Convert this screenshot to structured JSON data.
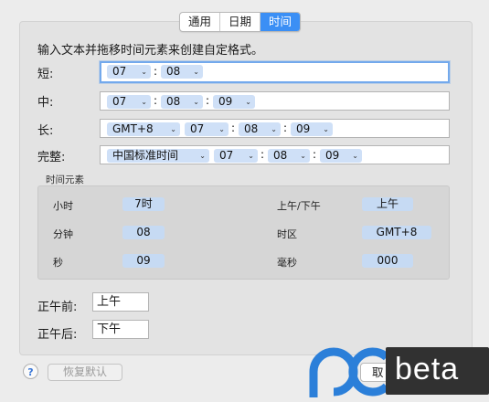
{
  "tabs": [
    {
      "label": "通用",
      "active": false
    },
    {
      "label": "日期",
      "active": false
    },
    {
      "label": "时间",
      "active": true
    }
  ],
  "instruction": "输入文本并拖移时间元素来创建自定格式。",
  "formats": [
    {
      "label": "短:",
      "tokens": [
        "07",
        "08"
      ],
      "seps": [
        ":"
      ]
    },
    {
      "label": "中:",
      "tokens": [
        "07",
        "08",
        "09"
      ],
      "seps": [
        ":",
        ":"
      ]
    },
    {
      "label": "长:",
      "tokens": [
        "GMT+8",
        "07",
        "08",
        "09"
      ],
      "seps": [
        "",
        ":",
        ":"
      ]
    },
    {
      "label": "完整:",
      "tokens": [
        "中国标准时间",
        "07",
        "08",
        "09"
      ],
      "seps": [
        "",
        ":",
        ":"
      ]
    }
  ],
  "elements": {
    "title": "时间元素",
    "items": [
      {
        "label": "小时",
        "value": "7时"
      },
      {
        "label": "上午/下午",
        "value": "上午"
      },
      {
        "label": "分钟",
        "value": "08"
      },
      {
        "label": "时区",
        "value": "GMT+8"
      },
      {
        "label": "秒",
        "value": "09"
      },
      {
        "label": "毫秒",
        "value": "000"
      }
    ]
  },
  "ampm": {
    "am_label": "正午前:",
    "am_value": "上午",
    "pm_label": "正午后:",
    "pm_value": "下午"
  },
  "footer": {
    "help": "?",
    "restore": "恢复默认",
    "cancel": "取"
  },
  "watermark": {
    "text": "beta"
  },
  "colors": {
    "accent": "#3b8ff5",
    "token": "#cfe0f7",
    "chip": "#c6daf3",
    "focus_ring": "#73a9ec",
    "logo_blue": "#2b7fd9"
  }
}
